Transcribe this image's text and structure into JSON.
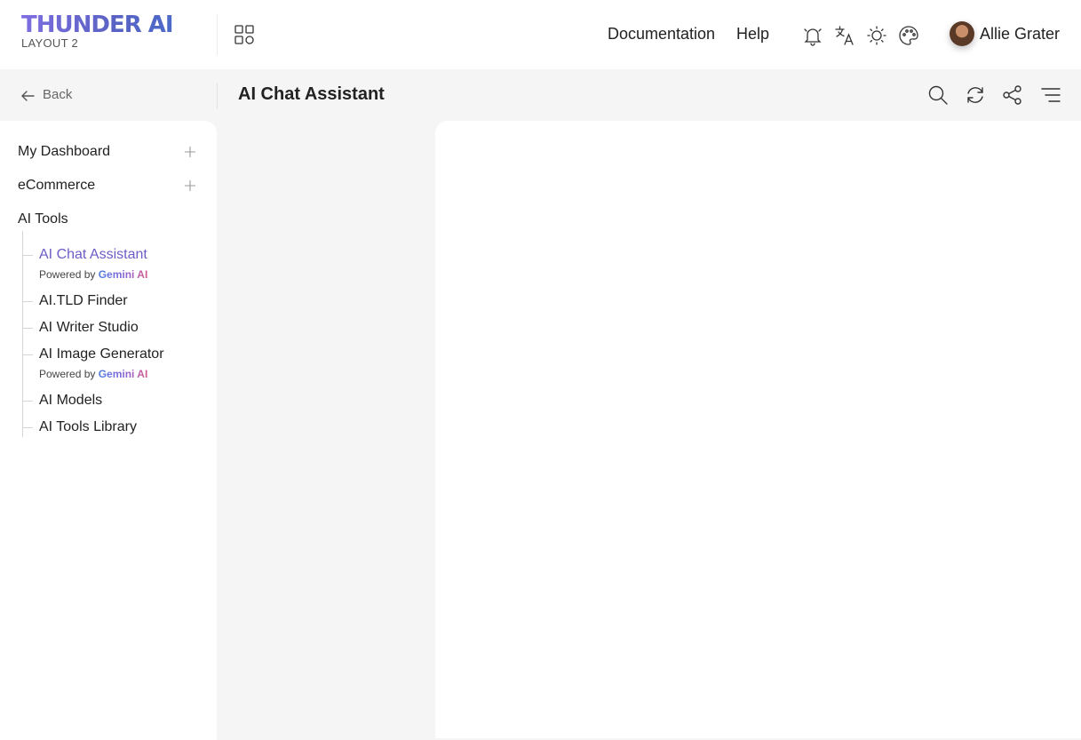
{
  "brand": {
    "title": "THUNDER AI",
    "subtitle": "LAYOUT 2"
  },
  "header": {
    "nav": [
      {
        "label": "Documentation"
      },
      {
        "label": "Help"
      }
    ],
    "icons": [
      "bell-icon",
      "translate-icon",
      "sun-icon",
      "palette-icon"
    ],
    "user": {
      "name": "Allie Grater"
    }
  },
  "subheader": {
    "back_label": "Back",
    "title": "AI Chat Assistant"
  },
  "sidebar": {
    "items": [
      {
        "label": "My Dashboard"
      },
      {
        "label": "eCommerce"
      },
      {
        "label": "AI Tools"
      }
    ],
    "ai_tools": [
      {
        "label": "AI Chat Assistant",
        "powered_prefix": "Powered by",
        "powered_brand": "Gemini AI"
      },
      {
        "label": "AI.TLD Finder"
      },
      {
        "label": "AI Writer Studio"
      },
      {
        "label": "AI Image Generator",
        "powered_prefix": "Powered by",
        "powered_brand": "Gemini AI"
      },
      {
        "label": "AI Models"
      },
      {
        "label": "AI Tools Library"
      }
    ]
  },
  "colors": {
    "accent": "#6c5dc7",
    "background": "#f5f5f5",
    "surface": "#ffffff"
  }
}
